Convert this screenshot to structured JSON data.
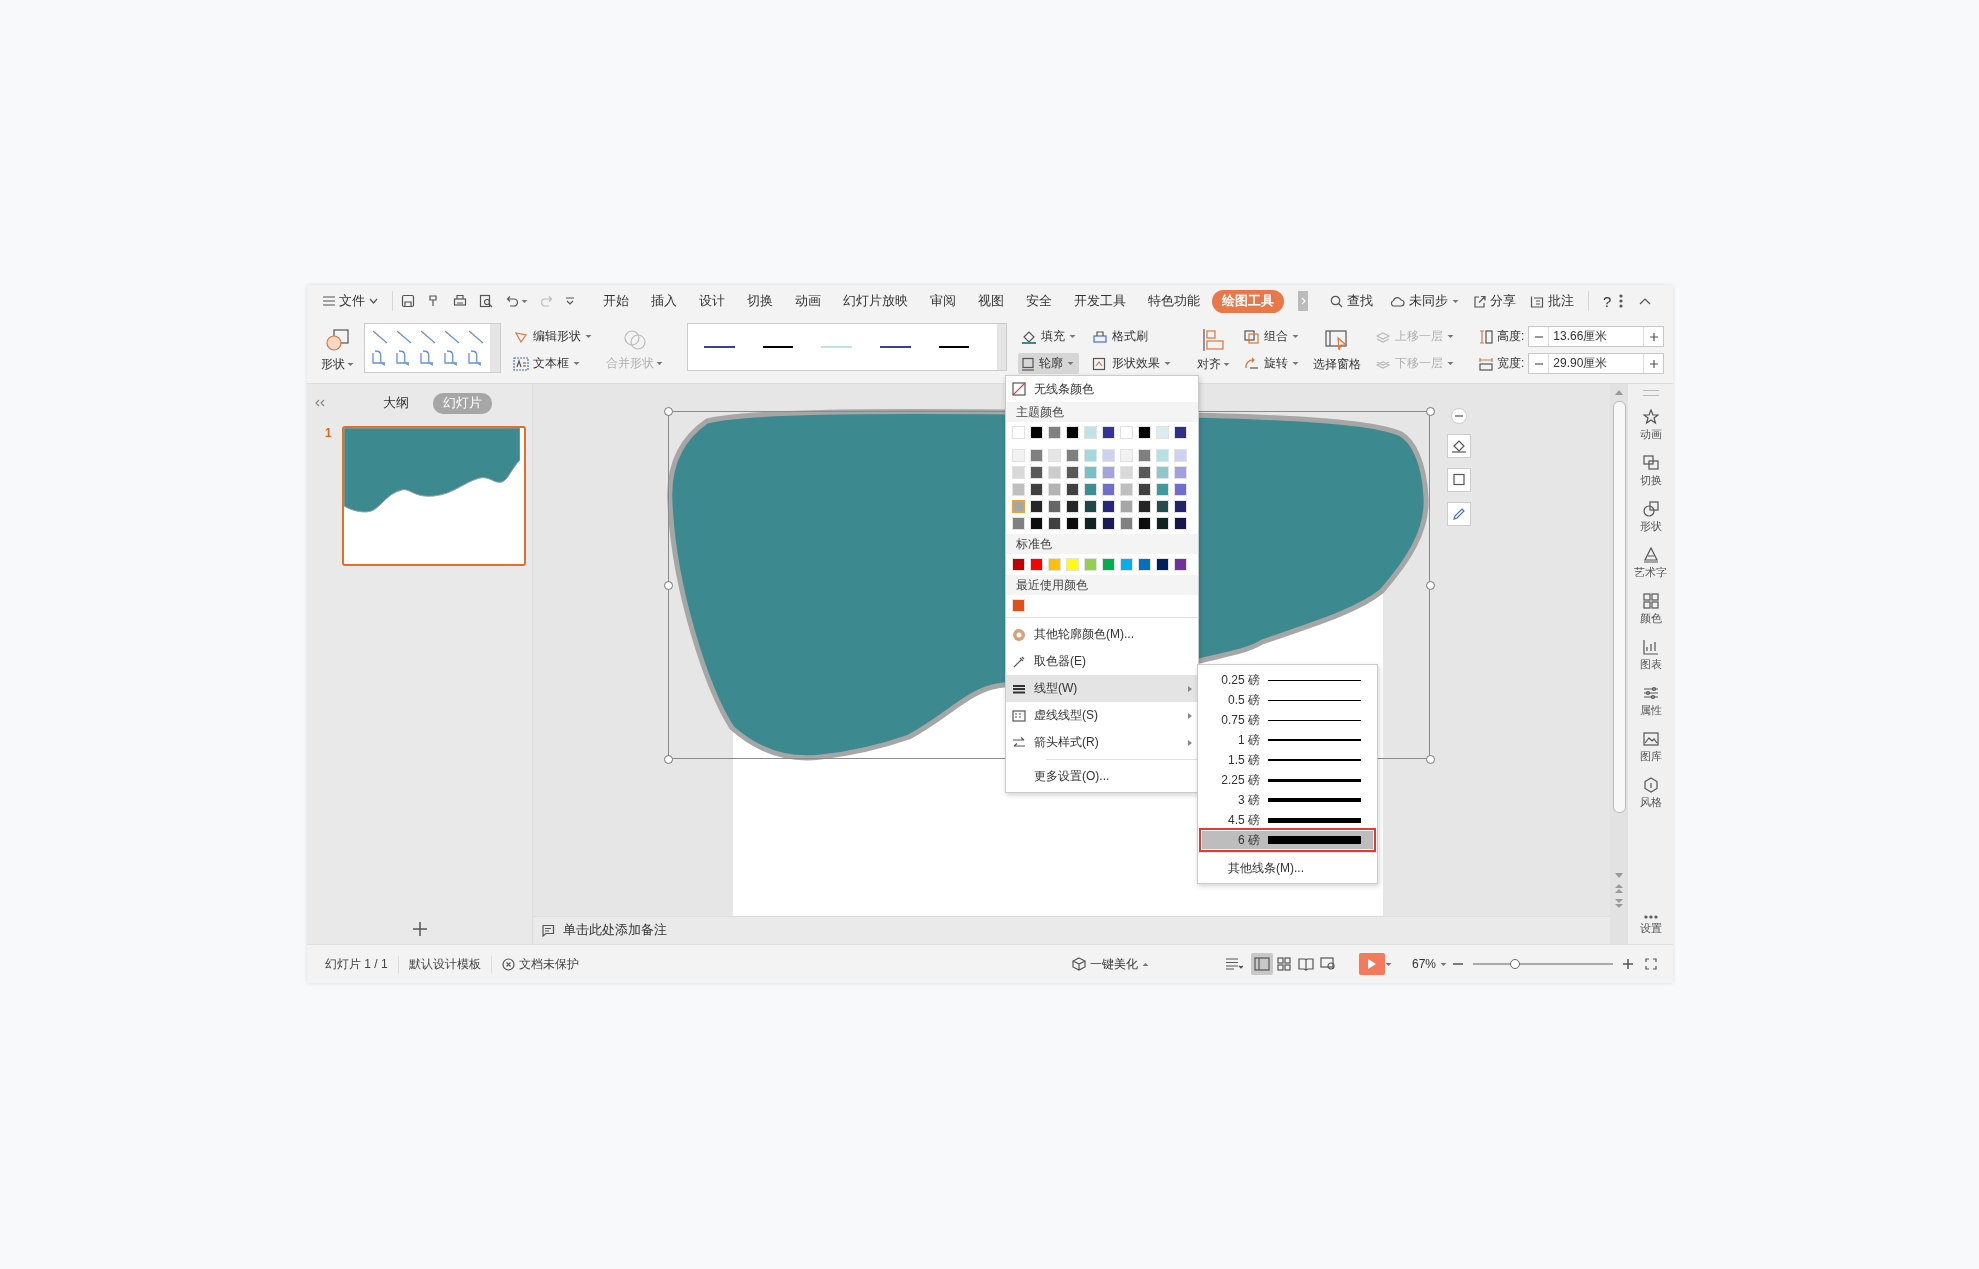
{
  "menu_bar": {
    "file": "文件",
    "tabs": [
      {
        "label": "开始",
        "selected": false
      },
      {
        "label": "插入",
        "selected": false
      },
      {
        "label": "设计",
        "selected": false
      },
      {
        "label": "切换",
        "selected": false
      },
      {
        "label": "动画",
        "selected": false
      },
      {
        "label": "幻灯片放映",
        "selected": false
      },
      {
        "label": "审阅",
        "selected": false
      },
      {
        "label": "视图",
        "selected": false
      },
      {
        "label": "安全",
        "selected": false
      },
      {
        "label": "开发工具",
        "selected": false
      },
      {
        "label": "特色功能",
        "selected": false
      },
      {
        "label": "绘图工具",
        "selected": true
      }
    ],
    "search": "查找",
    "sync": "未同步",
    "share": "分享",
    "comment": "批注",
    "help": "?"
  },
  "ribbon": {
    "shape": "形状",
    "edit_shape": "编辑形状",
    "text_box": "文本框",
    "merge_shape": {
      "label": "合并形状",
      "disabled": true
    },
    "line_presets": [
      {
        "color": "#3b3f9a"
      },
      {
        "color": "#000000"
      },
      {
        "color": "#bfe3e6"
      },
      {
        "color": "#3b3f9a"
      },
      {
        "color": "#000000"
      }
    ],
    "fill": "填充",
    "format_painter": "格式刷",
    "outline": {
      "label": "轮廓",
      "selected": true
    },
    "shape_effects": "形状效果",
    "align": "对齐",
    "group": "组合",
    "rotate": "旋转",
    "selection_pane": "选择窗格",
    "bring_forward": {
      "label": "上移一层",
      "disabled": true
    },
    "send_backward": {
      "label": "下移一层",
      "disabled": true
    },
    "size_fields": [
      {
        "label": "高度:",
        "value": "13.66厘米"
      },
      {
        "label": "宽度:",
        "value": "29.90厘米"
      }
    ]
  },
  "left_panel": {
    "tabs": [
      {
        "label": "大纲",
        "selected": false
      },
      {
        "label": "幻灯片",
        "selected": true
      }
    ],
    "slides": [
      {
        "number": "1",
        "selected": true
      }
    ]
  },
  "notes_placeholder": "单击此处添加备注",
  "right_sidebar": {
    "items": [
      "动画",
      "切换",
      "形状",
      "艺术字",
      "颜色",
      "图表",
      "属性",
      "图库",
      "风格"
    ],
    "settings": "设置"
  },
  "outline_menu": {
    "no_line": "无线条颜色",
    "sections": [
      {
        "heading": "主题颜色",
        "rows": [
          [
            {
              "color": "#ffffff",
              "selected": false
            },
            {
              "color": "#000000",
              "selected": false
            },
            {
              "color": "#808080",
              "selected": false
            },
            {
              "color": "#000000",
              "selected": false
            },
            {
              "color": "#bfe3e6",
              "selected": false
            },
            {
              "color": "#33339a",
              "selected": false
            },
            {
              "color": "#ffffff",
              "selected": false
            },
            {
              "color": "#000000",
              "selected": false
            },
            {
              "color": "#d9ecee",
              "selected": false
            },
            {
              "color": "#2e2e8c",
              "selected": false
            }
          ],
          [
            {
              "color": "#f2f2f2",
              "selected": false
            },
            {
              "color": "#808080",
              "selected": false
            },
            {
              "color": "#e6e6e6",
              "selected": false
            },
            {
              "color": "#808080",
              "selected": false
            },
            {
              "color": "#a3d8dc",
              "selected": false
            },
            {
              "color": "#d0d0f0",
              "selected": false
            },
            {
              "color": "#f2f2f2",
              "selected": false
            },
            {
              "color": "#808080",
              "selected": false
            },
            {
              "color": "#b8dfe2",
              "selected": false
            },
            {
              "color": "#d0d0f0",
              "selected": false
            }
          ],
          [
            {
              "color": "#d9d9d9",
              "selected": false
            },
            {
              "color": "#595959",
              "selected": false
            },
            {
              "color": "#cccccc",
              "selected": false
            },
            {
              "color": "#595959",
              "selected": false
            },
            {
              "color": "#74c1c6",
              "selected": false
            },
            {
              "color": "#a3a3e0",
              "selected": false
            },
            {
              "color": "#d9d9d9",
              "selected": false
            },
            {
              "color": "#595959",
              "selected": false
            },
            {
              "color": "#8cc8cc",
              "selected": false
            },
            {
              "color": "#a0a0e0",
              "selected": false
            }
          ],
          [
            {
              "color": "#bfbfbf",
              "selected": false
            },
            {
              "color": "#404040",
              "selected": false
            },
            {
              "color": "#b3b3b3",
              "selected": false
            },
            {
              "color": "#404040",
              "selected": false
            },
            {
              "color": "#3d8d91",
              "selected": false
            },
            {
              "color": "#7070cc",
              "selected": false
            },
            {
              "color": "#bfbfbf",
              "selected": false
            },
            {
              "color": "#404040",
              "selected": false
            },
            {
              "color": "#3e9a9a",
              "selected": false
            },
            {
              "color": "#6e6ed0",
              "selected": false
            }
          ],
          [
            {
              "color": "#a6a6a6",
              "selected": true
            },
            {
              "color": "#262626",
              "selected": false
            },
            {
              "color": "#666666",
              "selected": false
            },
            {
              "color": "#262626",
              "selected": false
            },
            {
              "color": "#1f4748",
              "selected": false
            },
            {
              "color": "#262680",
              "selected": false
            },
            {
              "color": "#a6a6a6",
              "selected": false
            },
            {
              "color": "#262626",
              "selected": false
            },
            {
              "color": "#254c4d",
              "selected": false
            },
            {
              "color": "#22226f",
              "selected": false
            }
          ],
          [
            {
              "color": "#808080",
              "selected": false
            },
            {
              "color": "#0d0d0d",
              "selected": false
            },
            {
              "color": "#404040",
              "selected": false
            },
            {
              "color": "#0d0d0d",
              "selected": false
            },
            {
              "color": "#0f2324",
              "selected": false
            },
            {
              "color": "#1a1a55",
              "selected": false
            },
            {
              "color": "#808080",
              "selected": false
            },
            {
              "color": "#0d0d0d",
              "selected": false
            },
            {
              "color": "#112222",
              "selected": false
            },
            {
              "color": "#16164a",
              "selected": false
            }
          ]
        ]
      },
      {
        "heading": "标准色",
        "rows": [
          [
            {
              "color": "#c00000",
              "selected": false
            },
            {
              "color": "#ff0000",
              "selected": false
            },
            {
              "color": "#ffc000",
              "selected": false
            },
            {
              "color": "#ffff00",
              "selected": false
            },
            {
              "color": "#92d050",
              "selected": false
            },
            {
              "color": "#00b050",
              "selected": false
            },
            {
              "color": "#00b0f0",
              "selected": false
            },
            {
              "color": "#0070c0",
              "selected": false
            },
            {
              "color": "#002060",
              "selected": false
            },
            {
              "color": "#7030a0",
              "selected": false
            }
          ]
        ]
      },
      {
        "heading": "最近使用颜色",
        "rows": [
          [
            {
              "color": "#e2501a",
              "selected": false
            }
          ]
        ]
      }
    ],
    "items": [
      {
        "kind": "palette",
        "label": "其他轮廓颜色(M)...",
        "submenu": false,
        "selected": false
      },
      {
        "kind": "eyedropper",
        "label": "取色器(E)",
        "submenu": false,
        "selected": false
      },
      {
        "kind": "weight",
        "label": "线型(W)",
        "submenu": true,
        "selected": true
      },
      {
        "kind": "dash",
        "label": "虚线线型(S)",
        "submenu": true,
        "selected": false
      },
      {
        "kind": "arrows",
        "label": "箭头样式(R)",
        "submenu": true,
        "selected": false
      },
      {
        "kind": "plain",
        "label": "更多设置(O)...",
        "submenu": false,
        "selected": false
      }
    ]
  },
  "weight_menu": {
    "weights": [
      {
        "label": "0.25 磅",
        "selected": false
      },
      {
        "label": "0.5 磅",
        "selected": false
      },
      {
        "label": "0.75 磅",
        "selected": false
      },
      {
        "label": "1 磅",
        "selected": false
      },
      {
        "label": "1.5 磅",
        "selected": false
      },
      {
        "label": "2.25 磅",
        "selected": false
      },
      {
        "label": "3 磅",
        "selected": false
      },
      {
        "label": "4.5 磅",
        "selected": false
      },
      {
        "label": "6 磅",
        "selected": true
      }
    ],
    "more": "其他线条(M)..."
  },
  "status_bar": {
    "slide_count": "幻灯片 1 / 1",
    "template": "默认设计模板",
    "protection": "文档未保护",
    "beautify": "一键美化",
    "views": [
      {
        "kind": "normal",
        "selected": true
      },
      {
        "kind": "sorter",
        "selected": false
      },
      {
        "kind": "reading",
        "selected": false
      },
      {
        "kind": "presenter",
        "selected": false
      }
    ],
    "zoom": "67%",
    "zoom_slider": {
      "level": 0.3
    }
  }
}
